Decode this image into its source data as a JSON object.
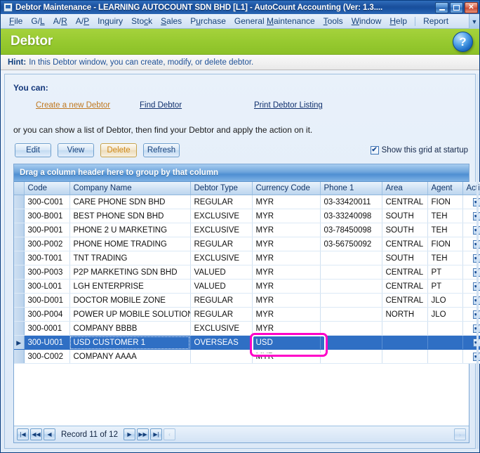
{
  "window": {
    "title": "Debtor Maintenance - LEARNING AUTOCOUNT SDN BHD [L1] - AutoCount Accounting (Ver: 1.3....",
    "minimize_label": "Minimize",
    "maximize_label": "Maximize",
    "close_label": "✕"
  },
  "menu": {
    "items": [
      {
        "pre": "",
        "key": "F",
        "post": "ile"
      },
      {
        "pre": "G/",
        "key": "L",
        "post": ""
      },
      {
        "pre": "A/",
        "key": "R",
        "post": ""
      },
      {
        "pre": "A/",
        "key": "P",
        "post": ""
      },
      {
        "pre": "In",
        "key": "q",
        "post": "uiry"
      },
      {
        "pre": "Sto",
        "key": "c",
        "post": "k"
      },
      {
        "pre": "",
        "key": "S",
        "post": "ales"
      },
      {
        "pre": "P",
        "key": "u",
        "post": "rchase"
      },
      {
        "pre": "General ",
        "key": "M",
        "post": "aintenance"
      },
      {
        "pre": "",
        "key": "T",
        "post": "ools"
      },
      {
        "pre": "",
        "key": "W",
        "post": "indow"
      },
      {
        "pre": "",
        "key": "H",
        "post": "elp"
      }
    ],
    "after_separator": [
      {
        "pre": "Report",
        "key": "",
        "post": ""
      }
    ],
    "overflow_icon": "chevron-down-icon",
    "overflow_glyph": "▼"
  },
  "header": {
    "title": "Debtor",
    "help_glyph": "?",
    "accent_color": "#96c92f"
  },
  "hint": {
    "label": "Hint:",
    "text": "In this Debtor window, you can create, modify, or delete debtor."
  },
  "panel": {
    "you_can_label": "You can:",
    "links": [
      {
        "label": "Create a new Debtor",
        "color": "#c07820"
      },
      {
        "label": "Find Debtor",
        "color": "#10306e"
      },
      {
        "label": "Print Debtor Listing",
        "color": "#10306e"
      }
    ],
    "description": "or you can show a list of Debtor, then find your Debtor and apply the action on it."
  },
  "toolbar": {
    "buttons": [
      {
        "label": "Edit",
        "state": "normal"
      },
      {
        "label": "View",
        "state": "normal"
      },
      {
        "label": "Delete",
        "state": "hover"
      },
      {
        "label": "Refresh",
        "state": "normal"
      }
    ],
    "checkbox": {
      "label": "Show this grid at startup",
      "checked": true,
      "glyph": "✔"
    }
  },
  "grid": {
    "group_panel_text": "Drag a column header here to group by that column",
    "columns": [
      "Code",
      "Company Name",
      "Debtor Type",
      "Currency Code",
      "Phone 1",
      "Area",
      "Agent",
      "Active"
    ],
    "rows": [
      {
        "code": "300-C001",
        "company": "CARE PHONE SDN BHD",
        "type": "REGULAR",
        "currency": "MYR",
        "phone": "03-33420011",
        "area": "CENTRAL",
        "agent": "FION",
        "active": true,
        "selected": false
      },
      {
        "code": "300-B001",
        "company": "BEST PHONE SDN BHD",
        "type": "EXCLUSIVE",
        "currency": "MYR",
        "phone": "03-33240098",
        "area": "SOUTH",
        "agent": "TEH",
        "active": true,
        "selected": false
      },
      {
        "code": "300-P001",
        "company": "PHONE 2 U MARKETING",
        "type": "EXCLUSIVE",
        "currency": "MYR",
        "phone": "03-78450098",
        "area": "SOUTH",
        "agent": "TEH",
        "active": true,
        "selected": false
      },
      {
        "code": "300-P002",
        "company": "PHONE HOME TRADING",
        "type": "REGULAR",
        "currency": "MYR",
        "phone": "03-56750092",
        "area": "CENTRAL",
        "agent": "FION",
        "active": true,
        "selected": false
      },
      {
        "code": "300-T001",
        "company": "TNT TRADING",
        "type": "EXCLUSIVE",
        "currency": "MYR",
        "phone": "",
        "area": "SOUTH",
        "agent": "TEH",
        "active": true,
        "selected": false
      },
      {
        "code": "300-P003",
        "company": "P2P MARKETING SDN BHD",
        "type": "VALUED",
        "currency": "MYR",
        "phone": "",
        "area": "CENTRAL",
        "agent": "PT",
        "active": true,
        "selected": false
      },
      {
        "code": "300-L001",
        "company": "LGH ENTERPRISE",
        "type": "VALUED",
        "currency": "MYR",
        "phone": "",
        "area": "CENTRAL",
        "agent": "PT",
        "active": true,
        "selected": false
      },
      {
        "code": "300-D001",
        "company": "DOCTOR MOBILE ZONE",
        "type": "REGULAR",
        "currency": "MYR",
        "phone": "",
        "area": "CENTRAL",
        "agent": "JLO",
        "active": true,
        "selected": false
      },
      {
        "code": "300-P004",
        "company": "POWER UP MOBILE SOLUTION",
        "type": "REGULAR",
        "currency": "MYR",
        "phone": "",
        "area": "NORTH",
        "agent": "JLO",
        "active": true,
        "selected": false
      },
      {
        "code": "300-0001",
        "company": "COMPANY BBBB",
        "type": "EXCLUSIVE",
        "currency": "MYR",
        "phone": "",
        "area": "",
        "agent": "",
        "active": true,
        "selected": false
      },
      {
        "code": "300-U001",
        "company": "USD CUSTOMER 1",
        "type": "OVERSEAS",
        "currency": "USD",
        "phone": "",
        "area": "",
        "agent": "",
        "active": true,
        "selected": true
      },
      {
        "code": "300-C002",
        "company": "COMPANY AAAA",
        "type": "",
        "currency": "MYR",
        "phone": "",
        "area": "",
        "agent": "",
        "active": true,
        "selected": false
      }
    ],
    "row_indicator_glyph": "▶",
    "check_glyph": "✔",
    "annotation": {
      "target": "currency-code-cell",
      "color": "#ff00c8"
    }
  },
  "footer": {
    "first_glyph": "|◀",
    "prev_page_glyph": "◀◀",
    "prev_glyph": "◀",
    "record_label": "Record 11 of 12",
    "next_glyph": "▶",
    "next_page_glyph": "▶▶",
    "last_glyph": "▶|",
    "collapse_glyph": "‹",
    "expand_glyph": "›"
  }
}
